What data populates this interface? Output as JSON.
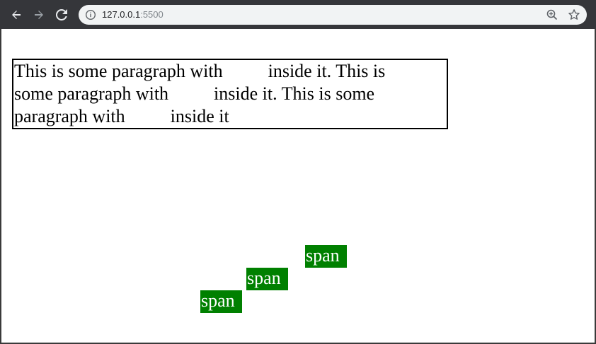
{
  "browser": {
    "url_host": "127.0.0.1",
    "url_port": ":5500",
    "icons": {
      "back": "arrow-left-icon",
      "forward": "arrow-right-icon",
      "reload": "reload-icon",
      "info": "info-icon",
      "zoom": "zoom-in-icon",
      "bookmark": "star-icon"
    }
  },
  "page": {
    "paragraph": {
      "line1_a": "This is some paragraph with",
      "line1_b": "inside it. This is",
      "line2_a": "some paragraph with",
      "line2_b": "inside it. This is some",
      "line3_a": "paragraph with",
      "line3_b": "inside it"
    },
    "spans": [
      "span",
      "span",
      "span"
    ],
    "colors": {
      "span_background": "#008000",
      "span_text": "#ffffff",
      "paragraph_border": "#000000"
    }
  }
}
